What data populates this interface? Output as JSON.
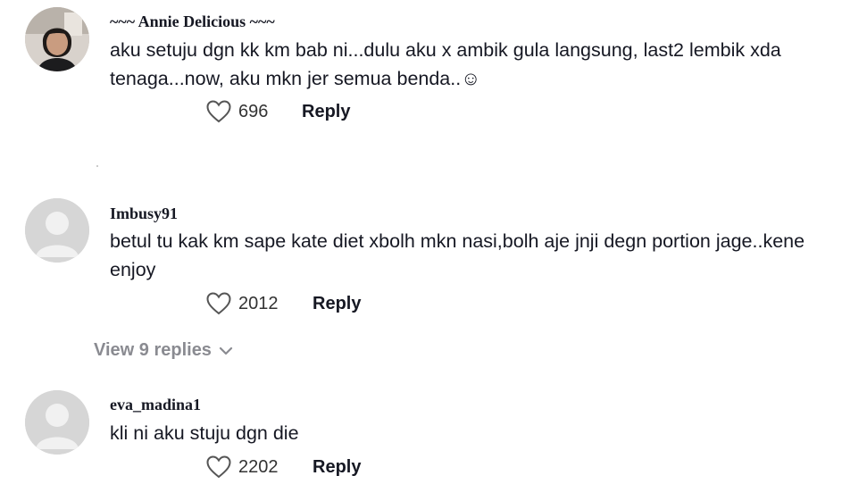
{
  "comments": [
    {
      "username": "~~~ Annie Delicious ~~~",
      "text": "aku setuju dgn kk km bab ni...dulu aku x ambik gula langsung, last2 lembik xda tenaga...now, aku mkn jer semua benda..☺",
      "likes": "696",
      "reply_label": "Reply"
    },
    {
      "username": "Imbusy91",
      "text": "betul tu kak km sape kate diet xbolh mkn nasi,bolh aje jnji degn portion jage..kene enjoy",
      "likes": "2012",
      "reply_label": "Reply"
    },
    {
      "username": "eva_madina1",
      "text": "kli ni aku stuju dgn die",
      "likes": "2202",
      "reply_label": "Reply"
    }
  ],
  "view_replies_label": "View 9 replies",
  "icons": {
    "like": "heart-outline-icon",
    "expand": "chevron-down-icon",
    "avatar_default": "default-user-icon"
  },
  "colors": {
    "text": "#161823",
    "muted": "#8a8b91",
    "avatar_bg": "#d6d6d6"
  }
}
